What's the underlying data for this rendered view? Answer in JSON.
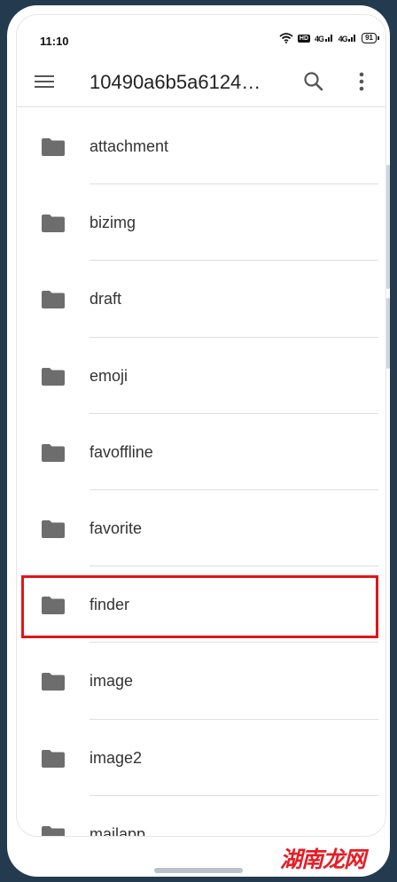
{
  "status_bar": {
    "time": "11:10",
    "hd_label": "HD",
    "signal_1": "4G",
    "signal_2": "4G",
    "battery_level": "91"
  },
  "app_bar": {
    "title": "10490a6b5a6124…",
    "icons": [
      "menu-icon",
      "search-icon",
      "more-vert-icon"
    ]
  },
  "files": [
    {
      "name": "attachment",
      "icon": "folder-icon"
    },
    {
      "name": "bizimg",
      "icon": "folder-icon"
    },
    {
      "name": "draft",
      "icon": "folder-icon"
    },
    {
      "name": "emoji",
      "icon": "folder-icon"
    },
    {
      "name": "favoffline",
      "icon": "folder-icon"
    },
    {
      "name": "favorite",
      "icon": "folder-icon"
    },
    {
      "name": "finder",
      "icon": "folder-icon",
      "highlighted": true
    },
    {
      "name": "image",
      "icon": "folder-icon"
    },
    {
      "name": "image2",
      "icon": "folder-icon"
    },
    {
      "name": "mailapp",
      "icon": "folder-icon"
    }
  ],
  "colors": {
    "highlight": "#e2141b",
    "folder": "#6d6d6d",
    "frame": "#243a4f"
  },
  "watermark": {
    "text": "湖南龙网"
  }
}
